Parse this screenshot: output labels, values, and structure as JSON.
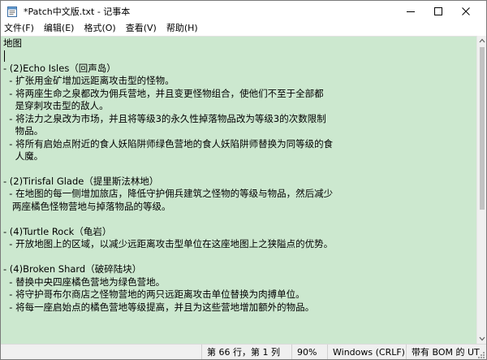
{
  "window": {
    "title": "*Patch中文版.txt - 记事本"
  },
  "menu": [
    {
      "label": "文件(F)"
    },
    {
      "label": "编辑(E)"
    },
    {
      "label": "格式(O)"
    },
    {
      "label": "查看(V)"
    },
    {
      "label": "帮助(H)"
    }
  ],
  "editor": {
    "lines": [
      "地图",
      "",
      "- (2)Echo Isles（回声岛）",
      "  - 扩张用金矿增加远距离攻击型的怪物。",
      "  - 将两座生命之泉都改为佣兵营地，并且变更怪物组合，使他们不至于全部都",
      "    是穿刺攻击型的敌人。",
      "  - 将法力之泉改为市场，并且将等级3的永久性掉落物品改为等级3的次数限制",
      "    物品。",
      "  - 将所有启始点附近的食人妖陷阱师绿色营地的食人妖陷阱师替换为同等级的食",
      "    人魔。",
      "",
      "- (2)Tirisfal Glade（提里斯法林地）",
      "  - 在地图的每一侧增加旅店，降低守护佣兵建筑之怪物的等级与物品，然后减少",
      "   两座橘色怪物营地与掉落物品的等级。",
      "",
      "- (4)Turtle Rock（龟岩）",
      "  - 开放地图上的区域，以减少远距离攻击型单位在这座地图上之狭隘点的优势。",
      "",
      "- (4)Broken Shard（破碎陆块）",
      "  - 替换中央四座橘色营地为绿色营地。",
      "  - 将守护哥布尔商店之怪物营地的两只远距离攻击单位替换为肉搏单位。",
      "  - 将每一座启始点的橘色营地等级提高，并且为这些营地增加额外的物品。"
    ]
  },
  "status": {
    "position": "第 66 行，第 1 列",
    "zoom": "90%",
    "line_ending": "Windows (CRLF)",
    "encoding": "带有 BOM 的 UT"
  },
  "colors": {
    "editor_bg": "#cce8cf",
    "chrome_bg": "#ffffff",
    "status_bg": "#f0f0f0"
  },
  "icons": {
    "app": "notepad-icon",
    "minimize": "minimize-icon",
    "maximize": "maximize-icon",
    "close": "close-icon",
    "scroll_up": "chevron-up-icon",
    "scroll_down": "chevron-down-icon",
    "grip": "resize-grip-icon"
  }
}
